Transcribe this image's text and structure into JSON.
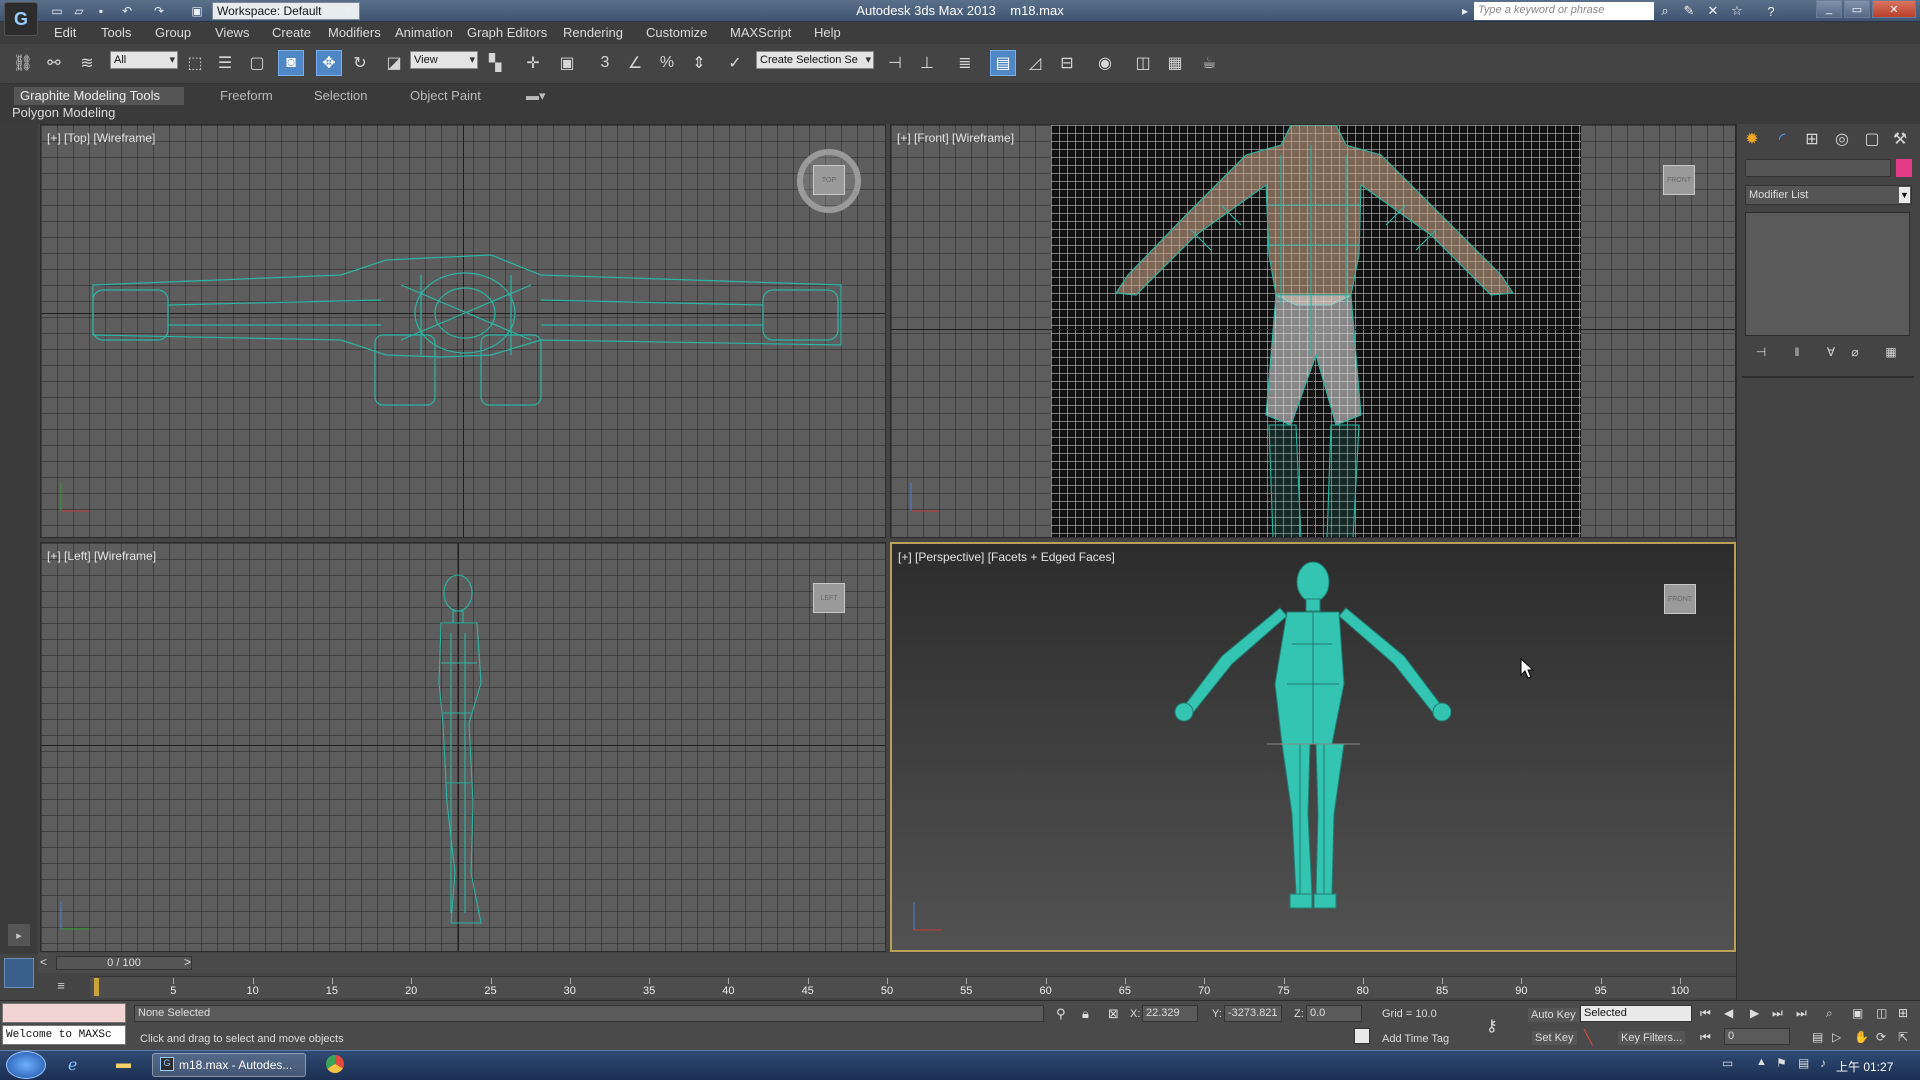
{
  "title_bar": {
    "title": "Autodesk 3ds Max 2013",
    "filename": "m18.max",
    "workspace": "Workspace: Default",
    "search_placeholder": "Type a keyword or phrase"
  },
  "menu": [
    "Edit",
    "Tools",
    "Group",
    "Views",
    "Create",
    "Modifiers",
    "Animation",
    "Graph Editors",
    "Rendering",
    "Customize",
    "MAXScript",
    "Help"
  ],
  "toolbar": {
    "selection_filter": "All",
    "ref_coord": "View",
    "named_selection": "Create Selection Se",
    "snap_label": "3",
    "angle_snap": "%"
  },
  "ribbon": {
    "tabs": [
      "Graphite Modeling Tools",
      "Freeform",
      "Selection",
      "Object Paint"
    ],
    "panel": "Polygon Modeling"
  },
  "viewports": {
    "top": {
      "label": "[+] [Top] [Wireframe]",
      "cube": "TOP"
    },
    "front": {
      "label": "[+] [Front] [Wireframe]",
      "cube": "FRONT"
    },
    "left": {
      "label": "[+] [Left] [Wireframe]",
      "cube": "LEFT"
    },
    "perspective": {
      "label": "[+] [Perspective] [Facets + Edged Faces]",
      "cube": "FRONT"
    }
  },
  "timeline": {
    "slider": "0 / 100",
    "prev": "<",
    "next": ">",
    "ticks": [
      "5",
      "10",
      "15",
      "20",
      "25",
      "30",
      "35",
      "40",
      "45",
      "50",
      "55",
      "60",
      "65",
      "70",
      "75",
      "80",
      "85",
      "90",
      "95",
      "100"
    ]
  },
  "command_panel": {
    "modifier_list": "Modifier List"
  },
  "status": {
    "maxscript": "Welcome to MAXSc",
    "selection": "None Selected",
    "prompt": "Click and drag to select and move objects",
    "x_label": "X:",
    "x_value": "22.329",
    "y_label": "Y:",
    "y_value": "-3273.821",
    "z_label": "Z:",
    "z_value": "0.0",
    "grid": "Grid = 10.0",
    "add_time_tag": "Add Time Tag",
    "auto_key": "Auto Key",
    "set_key": "Set Key",
    "key_mode": "Selected",
    "key_filters": "Key Filters...",
    "frame": "0"
  },
  "taskbar": {
    "app_button": "m18.max - Autodes...",
    "time": "上午 01:27"
  },
  "colors": {
    "wire": "#2bb5a3",
    "body": "#33c4b2",
    "viewport": "#5d5d5d",
    "active_border": "#b8a055"
  }
}
